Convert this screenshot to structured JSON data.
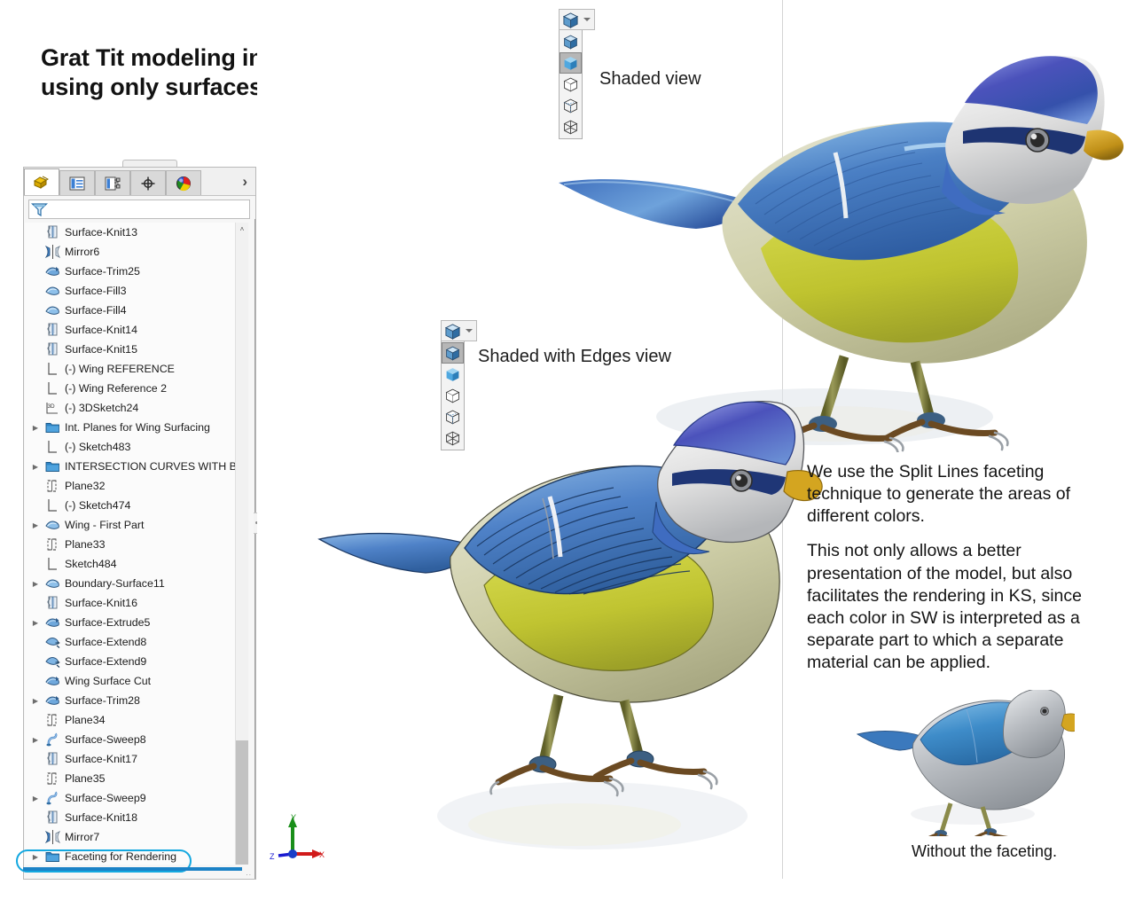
{
  "title": "Grat Tit modeling in SolidWorks\nusing only surfaces.",
  "title_line1": "Grat Tit modeling in SolidWorks",
  "title_line2": "using only surfaces.",
  "feature_manager": {
    "tabs": [
      {
        "name": "feature-manager-design-tree-tab",
        "icon": "yellow-feature-tree-icon",
        "active": true
      },
      {
        "name": "property-manager-tab",
        "icon": "property-list-icon",
        "active": false
      },
      {
        "name": "configuration-manager-tab",
        "icon": "configuration-icon",
        "active": false
      },
      {
        "name": "display-manager-tab",
        "icon": "crosshair-target-icon",
        "active": false
      },
      {
        "name": "appearances-tab",
        "icon": "color-ball-icon",
        "active": false
      }
    ],
    "more_tabs_label": "›",
    "filter_icon": "filter-funnel-icon",
    "filter_value": "",
    "filter_placeholder": "",
    "scroll": {
      "up_arrow": "˄",
      "thumb_position": "bottom"
    },
    "tree_items": [
      {
        "label": "Surface-Knit13",
        "icon": "surface-knit-icon",
        "arrow": false
      },
      {
        "label": "Mirror6",
        "icon": "mirror-icon",
        "arrow": false
      },
      {
        "label": "Surface-Trim25",
        "icon": "surface-trim-icon",
        "arrow": false
      },
      {
        "label": "Surface-Fill3",
        "icon": "surface-fill-icon",
        "arrow": false
      },
      {
        "label": "Surface-Fill4",
        "icon": "surface-fill-icon",
        "arrow": false
      },
      {
        "label": "Surface-Knit14",
        "icon": "surface-knit-icon",
        "arrow": false
      },
      {
        "label": "Surface-Knit15",
        "icon": "surface-knit-icon",
        "arrow": false
      },
      {
        "label": "(-) Wing REFERENCE",
        "icon": "sketch-icon",
        "arrow": false
      },
      {
        "label": "(-) Wing Reference 2",
        "icon": "sketch-icon",
        "arrow": false
      },
      {
        "label": "(-) 3DSketch24",
        "icon": "sketch-3d-icon",
        "arrow": false
      },
      {
        "label": "Int. Planes for Wing Surfacing",
        "icon": "folder-icon",
        "arrow": true
      },
      {
        "label": "(-) Sketch483",
        "icon": "sketch-icon",
        "arrow": false
      },
      {
        "label": "INTERSECTION CURVES WITH BODY",
        "icon": "folder-icon",
        "arrow": true
      },
      {
        "label": "Plane32",
        "icon": "plane-icon",
        "arrow": false
      },
      {
        "label": "(-) Sketch474",
        "icon": "sketch-icon",
        "arrow": false
      },
      {
        "label": "Wing - First Part",
        "icon": "surface-fill-icon",
        "arrow": true
      },
      {
        "label": "Plane33",
        "icon": "plane-icon",
        "arrow": false
      },
      {
        "label": "Sketch484",
        "icon": "sketch-icon",
        "arrow": false
      },
      {
        "label": "Boundary-Surface11",
        "icon": "surface-fill-icon",
        "arrow": true
      },
      {
        "label": "Surface-Knit16",
        "icon": "surface-knit-icon",
        "arrow": false
      },
      {
        "label": "Surface-Extrude5",
        "icon": "surface-trim-icon",
        "arrow": true
      },
      {
        "label": "Surface-Extend8",
        "icon": "surface-extend-icon",
        "arrow": false
      },
      {
        "label": "Surface-Extend9",
        "icon": "surface-extend-icon",
        "arrow": false
      },
      {
        "label": "Wing Surface Cut",
        "icon": "surface-trim-icon",
        "arrow": false
      },
      {
        "label": "Surface-Trim28",
        "icon": "surface-trim-icon",
        "arrow": true
      },
      {
        "label": "Plane34",
        "icon": "plane-icon",
        "arrow": false
      },
      {
        "label": "Surface-Sweep8",
        "icon": "surface-sweep-icon",
        "arrow": true
      },
      {
        "label": "Surface-Knit17",
        "icon": "surface-knit-icon",
        "arrow": false
      },
      {
        "label": "Plane35",
        "icon": "plane-icon",
        "arrow": false
      },
      {
        "label": "Surface-Sweep9",
        "icon": "surface-sweep-icon",
        "arrow": true
      },
      {
        "label": "Surface-Knit18",
        "icon": "surface-knit-icon",
        "arrow": false
      },
      {
        "label": "Mirror7",
        "icon": "mirror-icon",
        "arrow": false
      },
      {
        "label": "Faceting for Rendering",
        "icon": "folder-icon",
        "arrow": true,
        "highlighted": true
      }
    ]
  },
  "view_toolbars": [
    {
      "id": "shaded-view-toolbar",
      "label": "Shaded view",
      "selected_index": 1,
      "items": [
        {
          "name": "shaded-with-edges-option",
          "icon": "cube-shaded-edges-icon"
        },
        {
          "name": "shaded-option",
          "icon": "cube-shaded-icon"
        },
        {
          "name": "hidden-lines-removed-option",
          "icon": "cube-outline-icon"
        },
        {
          "name": "hidden-lines-visible-option",
          "icon": "cube-hidden-dashed-icon"
        },
        {
          "name": "wireframe-option",
          "icon": "cube-wireframe-icon"
        }
      ]
    },
    {
      "id": "shaded-with-edges-view-toolbar",
      "label": "Shaded with Edges view",
      "selected_index": 0,
      "items": [
        {
          "name": "shaded-with-edges-option",
          "icon": "cube-shaded-edges-icon"
        },
        {
          "name": "shaded-option",
          "icon": "cube-shaded-icon"
        },
        {
          "name": "hidden-lines-removed-option",
          "icon": "cube-outline-icon"
        },
        {
          "name": "hidden-lines-visible-option",
          "icon": "cube-hidden-dashed-icon"
        },
        {
          "name": "wireframe-option",
          "icon": "cube-wireframe-icon"
        }
      ]
    }
  ],
  "annotations": {
    "paragraph_1": "We use the Split Lines faceting technique to generate the areas of different colors.",
    "paragraph_2": "This not only allows a better presentation of the model, but also facilitates the rendering in KS, since each color in SW is interpreted as a separate part to which a separate material can be applied.",
    "thumb_caption": "Without the faceting."
  },
  "colors": {
    "highlight_cyan": "#14a8e0",
    "highlight_bar_blue": "#1b82c6",
    "bird_crown_blue": "#3a53b7",
    "bird_wing_blue": "#4f82c8",
    "bird_breast_yellow": "#c3c734",
    "bird_flank_olive": "#c9c9a3",
    "bird_beak_gold": "#d4a520",
    "bird_leg_olive": "#8a8a4a",
    "bird_gray": "#b0b3b8",
    "axis_x_red": "#d11a1a",
    "axis_y_green": "#1a8f1a",
    "axis_z_blue": "#1a1ad1"
  },
  "triad": {
    "x_label": "X",
    "y_label": "Y",
    "z_label": "Z"
  }
}
